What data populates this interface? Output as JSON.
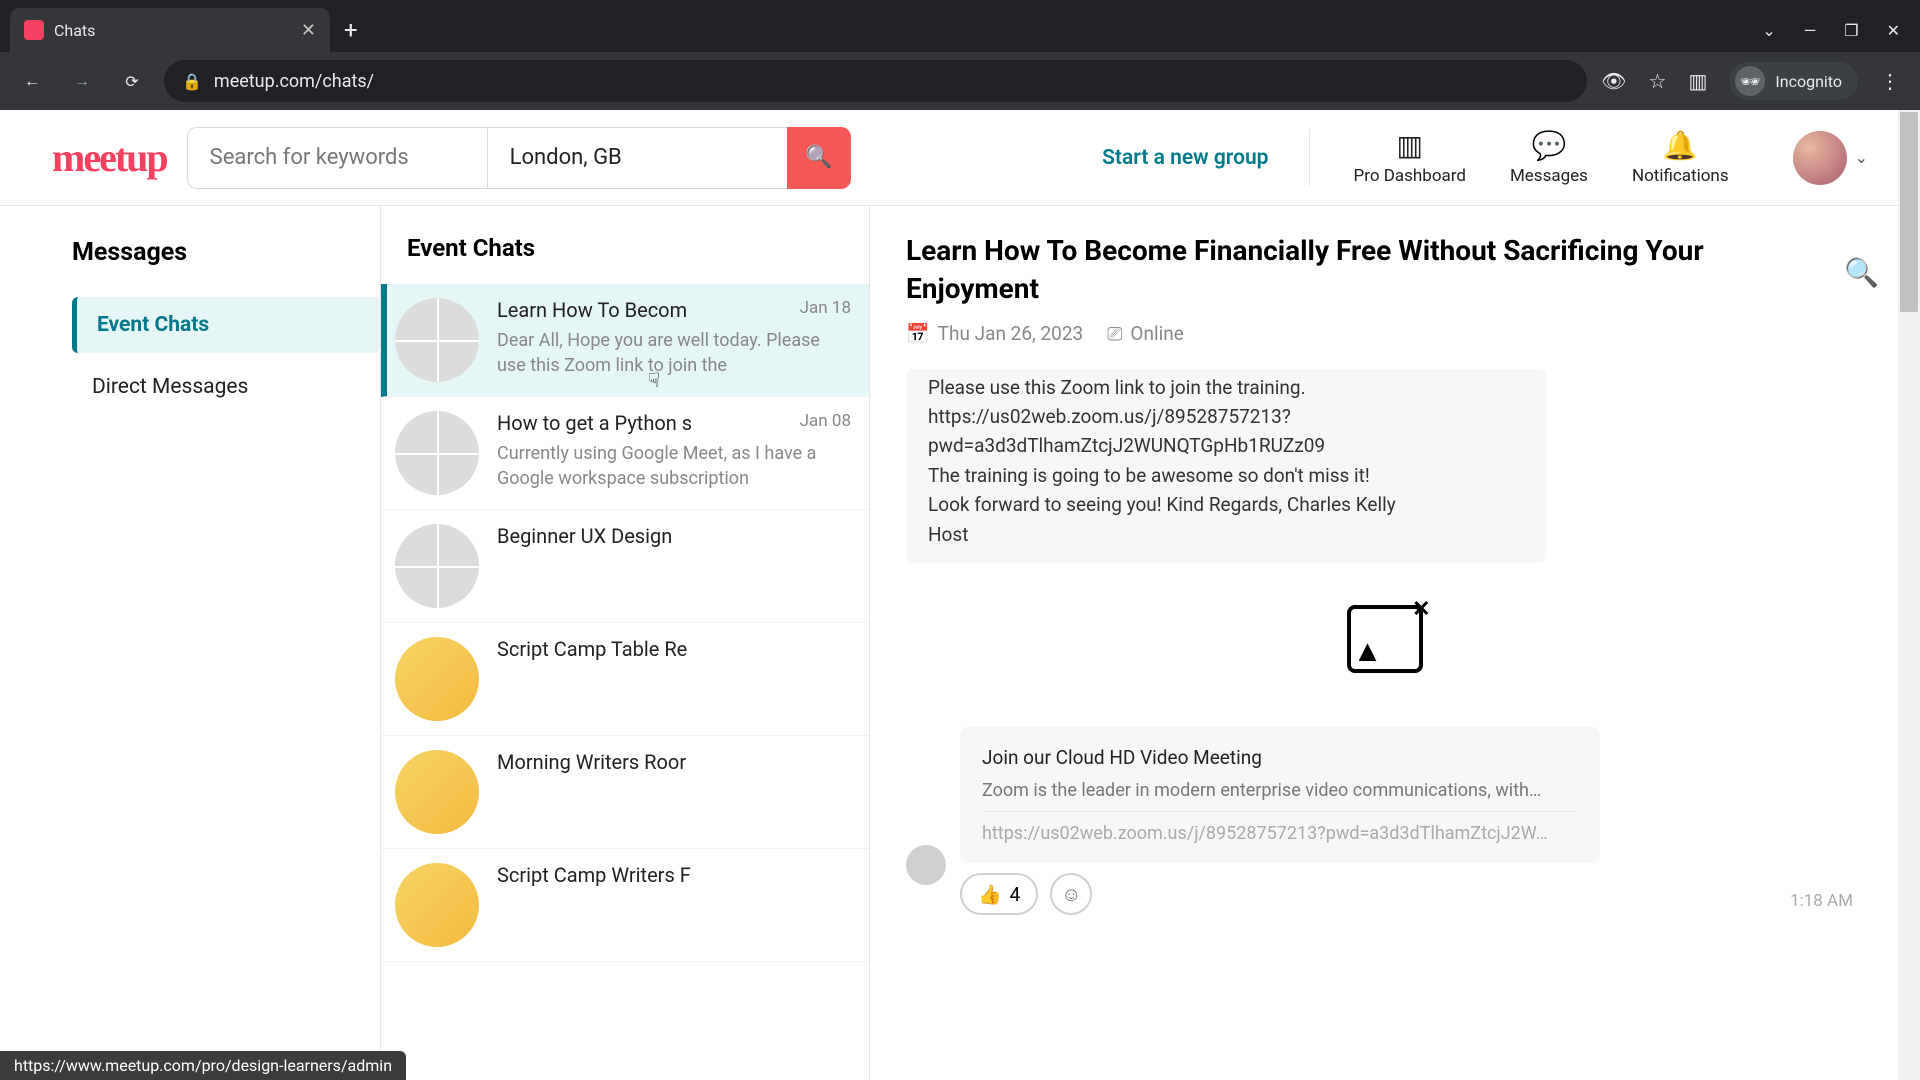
{
  "browser": {
    "tab_title": "Chats",
    "url": "meetup.com/chats/",
    "incognito_label": "Incognito",
    "status_url": "https://www.meetup.com/pro/design-learners/admin"
  },
  "header": {
    "logo_text": "meetup",
    "search_placeholder": "Search for keywords",
    "location": "London, GB",
    "start_group": "Start a new group",
    "actions": {
      "dashboard": "Pro Dashboard",
      "messages": "Messages",
      "notifications": "Notifications"
    }
  },
  "sidebar": {
    "title": "Messages",
    "items": [
      {
        "label": "Event Chats",
        "active": true
      },
      {
        "label": "Direct Messages",
        "active": false
      }
    ]
  },
  "chat_list": {
    "title": "Event Chats",
    "items": [
      {
        "title": "Learn How To Becom",
        "date": "Jan 18",
        "preview": "Dear All, Hope you are well today. Please use this Zoom link to join the"
      },
      {
        "title": "How to get a Python s",
        "date": "Jan 08",
        "preview": "Currently using Google Meet, as I have a Google workspace subscription"
      },
      {
        "title": "Beginner UX Design ",
        "date": "",
        "preview": ""
      },
      {
        "title": "Script Camp Table Re",
        "date": "",
        "preview": ""
      },
      {
        "title": "Morning Writers Roor",
        "date": "",
        "preview": ""
      },
      {
        "title": "Script Camp Writers F",
        "date": "",
        "preview": ""
      }
    ]
  },
  "conversation": {
    "title": "Learn How To Become Financially Free Without Sacrificing Your Enjoyment",
    "date": "Thu Jan 26, 2023",
    "mode": "Online",
    "message_lines": [
      "Please use this Zoom link to join the training.",
      "https://us02web.zoom.us/j/89528757213?",
      "pwd=a3d3dTlhamZtcjJ2WUNQTGpHb1RUZz09",
      "The training is going to be awesome so don't miss it!",
      "Look forward to seeing you! Kind Regards, Charles Kelly",
      "Host"
    ],
    "link_card": {
      "title": "Join our Cloud HD Video Meeting",
      "desc": "Zoom is the leader in modern enterprise video communications, with…",
      "url": "https://us02web.zoom.us/j/89528757213?pwd=a3d3dTlhamZtcjJ2W…"
    },
    "reaction_emoji": "👍",
    "reaction_count": "4",
    "time": "1:18 AM"
  }
}
